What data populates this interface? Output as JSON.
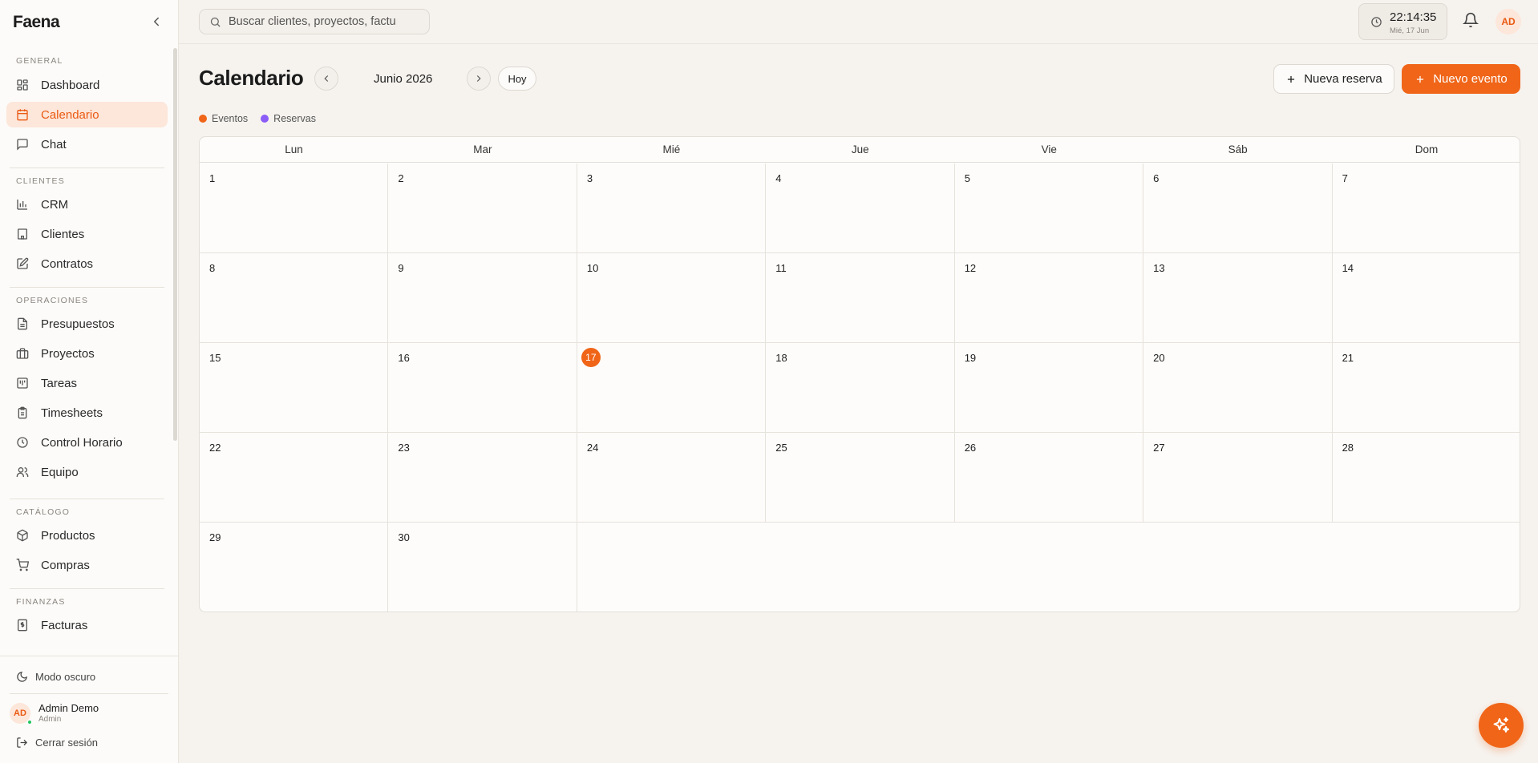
{
  "sidebar": {
    "brand": "Faena",
    "sections": [
      {
        "label": "General",
        "items": [
          {
            "label": "Dashboard",
            "icon": "dashboard-icon",
            "active": false
          },
          {
            "label": "Calendario",
            "icon": "calendar-icon",
            "active": true
          },
          {
            "label": "Chat",
            "icon": "chat-icon",
            "active": false
          }
        ]
      },
      {
        "label": "Clientes",
        "items": [
          {
            "label": "CRM",
            "icon": "bar-chart-icon",
            "active": false
          },
          {
            "label": "Clientes",
            "icon": "building-icon",
            "active": false
          },
          {
            "label": "Contratos",
            "icon": "contract-icon",
            "active": false
          }
        ]
      },
      {
        "label": "Operaciones",
        "items": [
          {
            "label": "Presupuestos",
            "icon": "document-icon",
            "active": false
          },
          {
            "label": "Proyectos",
            "icon": "briefcase-icon",
            "active": false
          },
          {
            "label": "Tareas",
            "icon": "kanban-icon",
            "active": false
          },
          {
            "label": "Timesheets",
            "icon": "clipboard-icon",
            "active": false
          },
          {
            "label": "Control Horario",
            "icon": "clock-icon",
            "active": false
          },
          {
            "label": "Equipo",
            "icon": "users-icon",
            "active": false
          }
        ]
      },
      {
        "label": "Catálogo",
        "items": [
          {
            "label": "Productos",
            "icon": "package-icon",
            "active": false
          },
          {
            "label": "Compras",
            "icon": "cart-icon",
            "active": false
          }
        ]
      },
      {
        "label": "Finanzas",
        "items": [
          {
            "label": "Facturas",
            "icon": "invoice-icon",
            "active": false
          }
        ]
      }
    ],
    "dark_mode_label": "Modo oscuro",
    "user": {
      "initials": "AD",
      "name": "Admin Demo",
      "role": "Admin"
    },
    "logout_label": "Cerrar sesión"
  },
  "topbar": {
    "search_placeholder": "Buscar clientes, proyectos, factu",
    "clock_time": "22:14:35",
    "clock_date": "Mié, 17 Jun",
    "avatar_initials": "AD"
  },
  "header": {
    "title": "Calendario",
    "month": "Junio 2026",
    "today_label": "Hoy",
    "new_booking_label": "Nueva reserva",
    "new_event_label": "Nuevo evento"
  },
  "legend": [
    {
      "label": "Eventos",
      "color": "#f06518"
    },
    {
      "label": "Reservas",
      "color": "#8b5cf6"
    }
  ],
  "calendar": {
    "weekdays": [
      "Lun",
      "Mar",
      "Mié",
      "Jue",
      "Vie",
      "Sáb",
      "Dom"
    ],
    "weeks": [
      [
        "1",
        "2",
        "3",
        "4",
        "5",
        "6",
        "7"
      ],
      [
        "8",
        "9",
        "10",
        "11",
        "12",
        "13",
        "14"
      ],
      [
        "15",
        "16",
        "17",
        "18",
        "19",
        "20",
        "21"
      ],
      [
        "22",
        "23",
        "24",
        "25",
        "26",
        "27",
        "28"
      ],
      [
        "29",
        "30",
        "",
        "",
        "",
        "",
        ""
      ]
    ],
    "today": "17"
  },
  "colors": {
    "accent": "#f06518",
    "active_bg": "#fde6da"
  }
}
